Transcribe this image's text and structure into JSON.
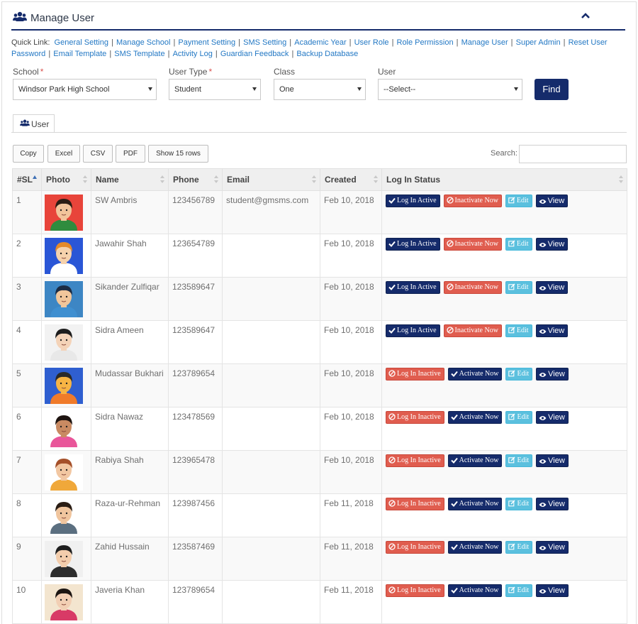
{
  "header": {
    "title": "Manage User"
  },
  "quick_links": {
    "label": "Quick Link:",
    "items": [
      "General Setting",
      "Manage School",
      "Payment Setting",
      "SMS Setting",
      "Academic Year",
      "User Role",
      "Role Permission",
      "Manage User",
      "Super Admin",
      "Reset User Password",
      "Email Template",
      "SMS Template",
      "Activity Log",
      "Guardian Feedback",
      "Backup Database"
    ]
  },
  "filters": {
    "school": {
      "label": "School",
      "required": "*",
      "value": "Windsor Park High School"
    },
    "user_type": {
      "label": "User Type",
      "required": "*",
      "value": "Student"
    },
    "class": {
      "label": "Class",
      "value": "One"
    },
    "user": {
      "label": "User",
      "value": "--Select--"
    },
    "find_label": "Find"
  },
  "tab": {
    "label": "User"
  },
  "toolbar": {
    "copy": "Copy",
    "excel": "Excel",
    "csv": "CSV",
    "pdf": "PDF",
    "rows": "Show 15 rows",
    "search_label": "Search:"
  },
  "table": {
    "columns": {
      "sl": "#SL",
      "photo": "Photo",
      "name": "Name",
      "phone": "Phone",
      "email": "Email",
      "created": "Created",
      "status": "Log In Status"
    },
    "actions": {
      "login_active": "Log In Active",
      "login_inactive": "Log In Inactive",
      "inactivate": "Inactivate Now",
      "activate": "Activate Now",
      "edit": "Edit",
      "view": "View"
    },
    "rows": [
      {
        "sl": "1",
        "name": "SW Ambris",
        "phone": "123456789",
        "email": "student@gmsms.com",
        "created": "Feb 10, 2018",
        "active": true,
        "bg": "#e8443a",
        "skin": "#f2c49b",
        "hair": "#2b1d14",
        "shirt": "#2f8c3e"
      },
      {
        "sl": "2",
        "name": "Jawahir Shah",
        "phone": "123654789",
        "email": "",
        "created": "Feb 10, 2018",
        "active": true,
        "bg": "#2a56d6",
        "skin": "#f6d2ac",
        "hair": "#e58a2a",
        "shirt": "#ffffff"
      },
      {
        "sl": "3",
        "name": "Sikander Zulfiqar",
        "phone": "123589647",
        "email": "",
        "created": "Feb 10, 2018",
        "active": true,
        "bg": "#3d86c4",
        "skin": "#f1c69b",
        "hair": "#1b2b44",
        "shirt": "#3f8fd0"
      },
      {
        "sl": "4",
        "name": "Sidra Ameen",
        "phone": "123589647",
        "email": "",
        "created": "Feb 10, 2018",
        "active": true,
        "bg": "#f2f2f2",
        "skin": "#f4d3b8",
        "hair": "#1d1d1d",
        "shirt": "#e8e8e8"
      },
      {
        "sl": "5",
        "name": "Mudassar Bukhari",
        "phone": "123789654",
        "email": "",
        "created": "Feb 10, 2018",
        "active": false,
        "bg": "#2f5fd0",
        "skin": "#f7b444",
        "hair": "#2a2a2a",
        "shirt": "#f07b2a"
      },
      {
        "sl": "6",
        "name": "Sidra Nawaz",
        "phone": "123478569",
        "email": "",
        "created": "Feb 10, 2018",
        "active": false,
        "bg": "#ffffff",
        "skin": "#c98a62",
        "hair": "#1e1410",
        "shirt": "#e9569a"
      },
      {
        "sl": "7",
        "name": "Rabiya Shah",
        "phone": "123965478",
        "email": "",
        "created": "Feb 10, 2018",
        "active": false,
        "bg": "#ffffff",
        "skin": "#f2c7a2",
        "hair": "#a5502a",
        "shirt": "#f0a83a"
      },
      {
        "sl": "8",
        "name": "Raza-ur-Rehman",
        "phone": "123987456",
        "email": "",
        "created": "Feb 11, 2018",
        "active": false,
        "bg": "#ffffff",
        "skin": "#f0c59e",
        "hair": "#2a1d14",
        "shirt": "#5b6f80"
      },
      {
        "sl": "9",
        "name": "Zahid Hussain",
        "phone": "123587469",
        "email": "",
        "created": "Feb 11, 2018",
        "active": false,
        "bg": "#f0f0f0",
        "skin": "#f3cdac",
        "hair": "#1e1e1e",
        "shirt": "#2d2d2d"
      },
      {
        "sl": "10",
        "name": "Javeria Khan",
        "phone": "123789654",
        "email": "",
        "created": "Feb 11, 2018",
        "active": false,
        "bg": "#f3e5cf",
        "skin": "#f2cfb4",
        "hair": "#1c1512",
        "shirt": "#d83a66"
      }
    ]
  },
  "colors": {
    "primary": "#152b6b",
    "danger": "#e05d4f",
    "info": "#5bc0de",
    "link": "#2378c4"
  }
}
